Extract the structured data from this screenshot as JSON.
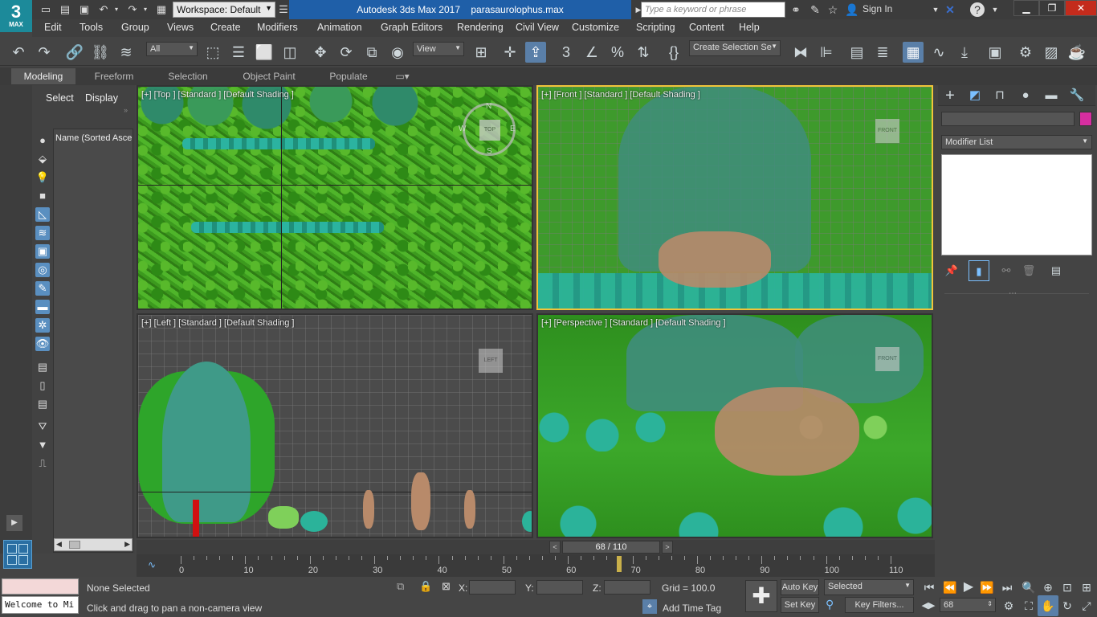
{
  "app": {
    "logo_main": "3",
    "logo_sub": "MAX",
    "workspace": "Workspace: Default",
    "app_title": "Autodesk 3ds Max 2017",
    "file_name": "parasaurolophus.max",
    "search_placeholder": "Type a keyword or phrase",
    "sign_in": "Sign In"
  },
  "menu": [
    "Edit",
    "Tools",
    "Group",
    "Views",
    "Create",
    "Modifiers",
    "Animation",
    "Graph Editors",
    "Rendering",
    "Civil View",
    "Customize",
    "Scripting",
    "Content",
    "Help"
  ],
  "toolbar": {
    "filter_value": "All",
    "refcoord_value": "View",
    "selection_set_value": "Create Selection Se"
  },
  "ribbon_tabs": [
    "Modeling",
    "Freeform",
    "Selection",
    "Object Paint",
    "Populate"
  ],
  "scene_explorer": {
    "tab_select": "Select",
    "tab_display": "Display",
    "column_header": "Name (Sorted Ascer"
  },
  "viewports": {
    "top": {
      "label": "[+] [Top ] [Standard ] [Default Shading ]",
      "cube": "TOP",
      "compass": {
        "n": "N",
        "s": "S",
        "e": "E",
        "w": "W"
      }
    },
    "front": {
      "label": "[+] [Front ] [Standard ] [Default Shading ]",
      "cube": "FRONT"
    },
    "left": {
      "label": "[+] [Left ] [Standard ] [Default Shading ]",
      "cube": "LEFT"
    },
    "perspective": {
      "label": "[+] [Perspective ] [Standard ] [Default Shading ]",
      "cube": "FRONT"
    }
  },
  "command_panel": {
    "modifier_list": "Modifier List",
    "swatch_color": "#d62ea0"
  },
  "timeline": {
    "frame_display": "68 / 110",
    "current_frame": 68,
    "total_frames": 110,
    "ticks": [
      "0",
      "10",
      "20",
      "30",
      "40",
      "50",
      "60",
      "70",
      "80",
      "90",
      "100",
      "110"
    ]
  },
  "status": {
    "maxscript_text": "Welcome to Mi",
    "selection_status": "None Selected",
    "prompt": "Click and drag to pan a non-camera view",
    "x_label": "X:",
    "y_label": "Y:",
    "z_label": "Z:",
    "grid": "Grid = 100.0",
    "add_time_tag": "Add Time Tag",
    "auto_key": "Auto Key",
    "set_key": "Set Key",
    "key_mode": "Selected",
    "key_filters": "Key Filters...",
    "frame_field": "68"
  },
  "colors": {
    "accent_blue": "#1f5fa8",
    "active_viewport": "#f0c43a",
    "grass": "#3c9a1e",
    "teal": "#2ab59a"
  }
}
